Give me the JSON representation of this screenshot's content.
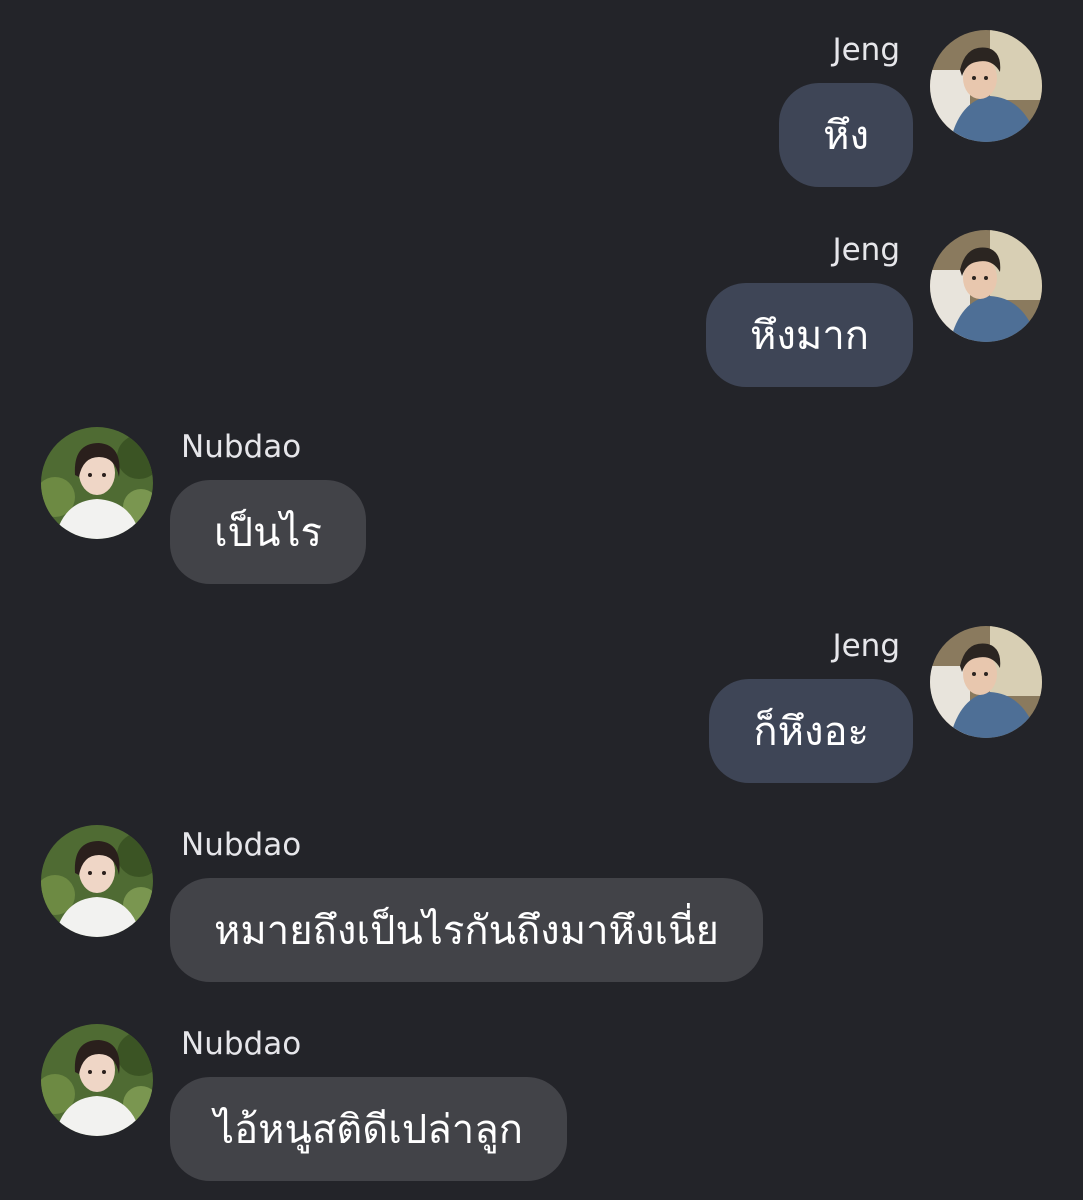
{
  "colors": {
    "background": "#232429",
    "outgoing_bubble": "#3e4556",
    "incoming_bubble": "#424348",
    "text": "#ffffff",
    "sender_name": "#e6e6ea"
  },
  "participants": {
    "jeng": {
      "name": "Jeng",
      "avatar_icon": "jeng-avatar"
    },
    "nubdao": {
      "name": "Nubdao",
      "avatar_icon": "nubdao-avatar"
    }
  },
  "messages": [
    {
      "sender": "Jeng",
      "side": "right",
      "text": "หึง"
    },
    {
      "sender": "Jeng",
      "side": "right",
      "text": "หึงมาก"
    },
    {
      "sender": "Nubdao",
      "side": "left",
      "text": "เป็นไร"
    },
    {
      "sender": "Jeng",
      "side": "right",
      "text": "ก็หึงอะ"
    },
    {
      "sender": "Nubdao",
      "side": "left",
      "text": "หมายถึงเป็นไรกันถึงมาหึงเนี่ย"
    },
    {
      "sender": "Nubdao",
      "side": "left",
      "text": "ไอ้หนูสติดีเปล่าลูก"
    }
  ]
}
